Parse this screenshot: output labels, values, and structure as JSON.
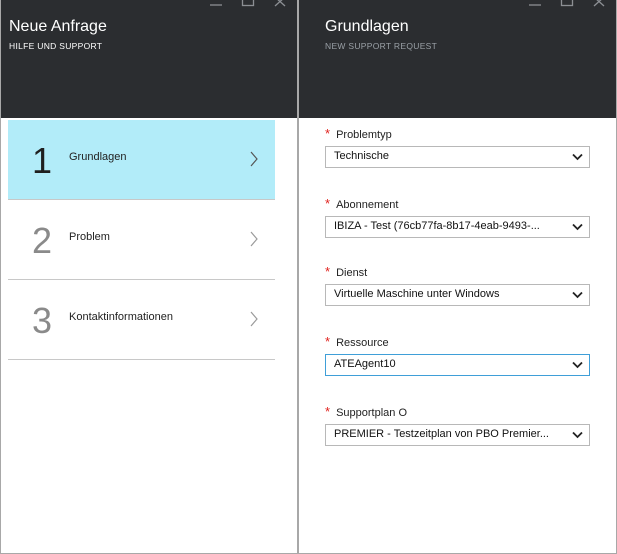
{
  "left_blade": {
    "title": "Neue Anfrage",
    "subtitle": "HILFE UND SUPPORT",
    "steps": [
      {
        "number": "1",
        "label": "Grundlagen",
        "active": true
      },
      {
        "number": "2",
        "label": "Problem",
        "active": false
      },
      {
        "number": "3",
        "label": "Kontaktinformationen",
        "active": false
      }
    ]
  },
  "right_blade": {
    "title": "Grundlagen",
    "subtitle": "NEW SUPPORT REQUEST",
    "required_mark": "*",
    "fields": [
      {
        "label": "Problemtyp",
        "value": "Technische"
      },
      {
        "label": "Abonnement",
        "value": "IBIZA - Test (76cb77fa-8b17-4eab-9493-..."
      },
      {
        "label": "Dienst",
        "value": "Virtuelle Maschine unter Windows"
      },
      {
        "label": "Ressource",
        "value": "ATEAgent10"
      },
      {
        "label": "Supportplan O",
        "value": "PREMIER - Testzeitplan von PBO Premier..."
      }
    ]
  },
  "icons": {
    "window_controls": [
      "minimize-icon",
      "maximize-icon",
      "close-icon"
    ],
    "step_chevron": "chevron-right-icon",
    "dropdown": "chevron-down-icon"
  },
  "colors": {
    "header_bg": "#2b2d30",
    "active_step_bg": "#b2ecf9",
    "required": "#e0211d",
    "focus_border": "#3f9fd8"
  }
}
